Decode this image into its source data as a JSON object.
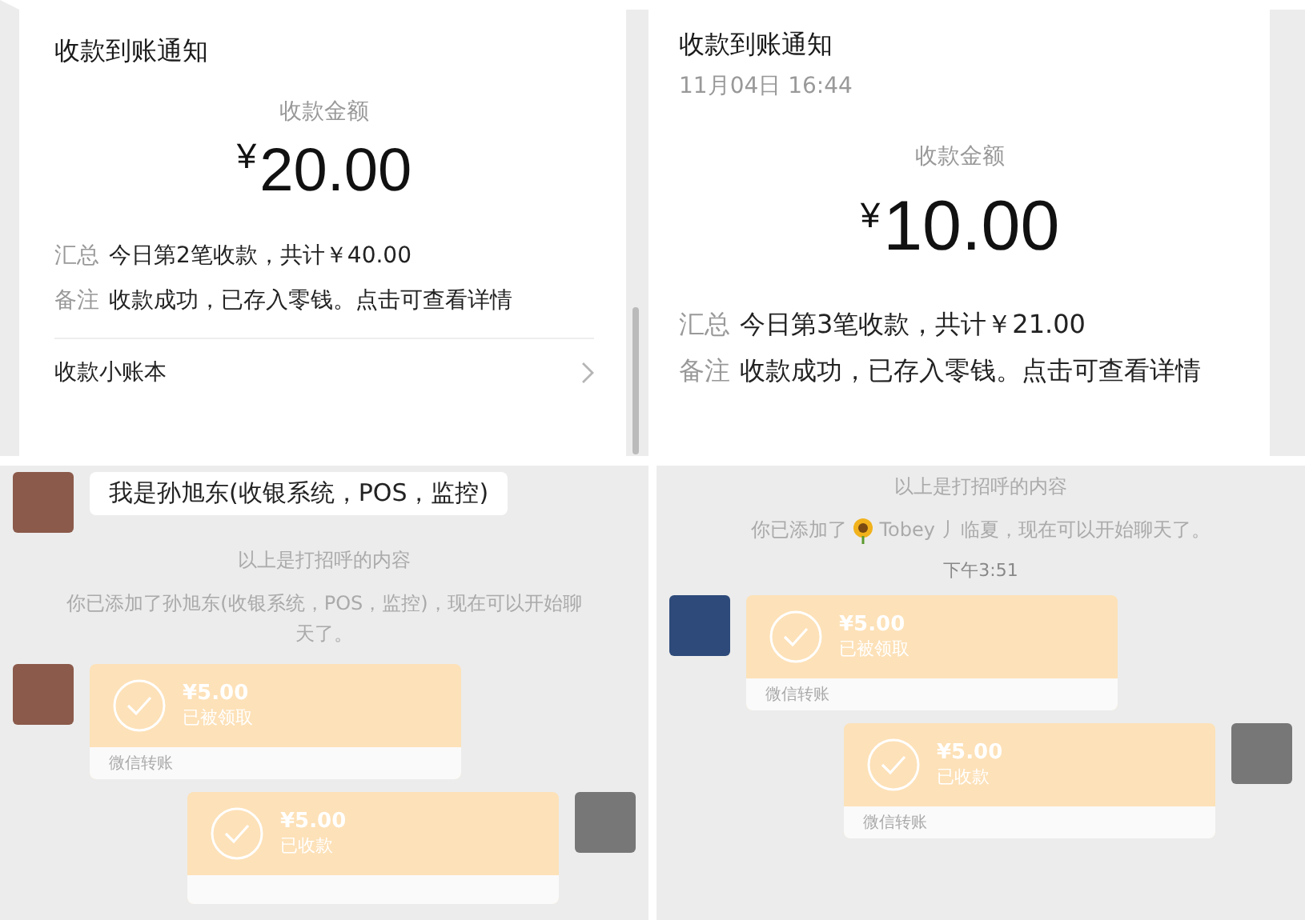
{
  "notifications": [
    {
      "title": "收款到账通知",
      "amount_label": "收款金额",
      "amount": "20.00",
      "currency": "¥",
      "rows": [
        {
          "label": "汇总",
          "value": "今日第2笔收款，共计￥40.00"
        },
        {
          "label": "备注",
          "value": "收款成功，已存入零钱。点击可查看详情"
        }
      ],
      "footer": "收款小账本"
    },
    {
      "title": "收款到账通知",
      "time": "11月04日 16:44",
      "amount_label": "收款金额",
      "amount": "10.00",
      "currency": "¥",
      "rows": [
        {
          "label": "汇总",
          "value": "今日第3笔收款，共计￥21.00"
        },
        {
          "label": "备注",
          "value": "收款成功，已存入零钱。点击可查看详情"
        }
      ]
    }
  ],
  "chats": [
    {
      "greeting": "我是孙旭东(收银系统，POS，监控)",
      "system_messages": [
        [
          {
            "kind": "text",
            "text": "以上是打招呼的内容"
          }
        ],
        [
          {
            "kind": "text",
            "text": "你已添加了孙旭东(收银系统，POS，监控)，现在可以开始聊天了。"
          }
        ]
      ],
      "transfers": [
        {
          "kind": "incoming",
          "amount": "¥5.00",
          "status": "已被领取",
          "footer": "微信转账"
        },
        {
          "kind": "outgoing",
          "amount": "¥5.00",
          "status": "已收款"
        }
      ]
    },
    {
      "system_messages": [
        [
          {
            "kind": "text",
            "text": "以上是打招呼的内容"
          }
        ],
        [
          {
            "kind": "text",
            "text": "你已添加了"
          },
          {
            "kind": "sunflower"
          },
          {
            "kind": "text",
            "text": "Tobey 丿临夏，现在可以开始聊天了。"
          }
        ]
      ],
      "time": "下午3:51",
      "transfers": [
        {
          "kind": "incoming",
          "amount": "¥5.00",
          "status": "已被领取",
          "footer": "微信转账"
        },
        {
          "kind": "outgoing",
          "amount": "¥5.00",
          "status": "已收款",
          "footer": "微信转账"
        }
      ]
    }
  ]
}
